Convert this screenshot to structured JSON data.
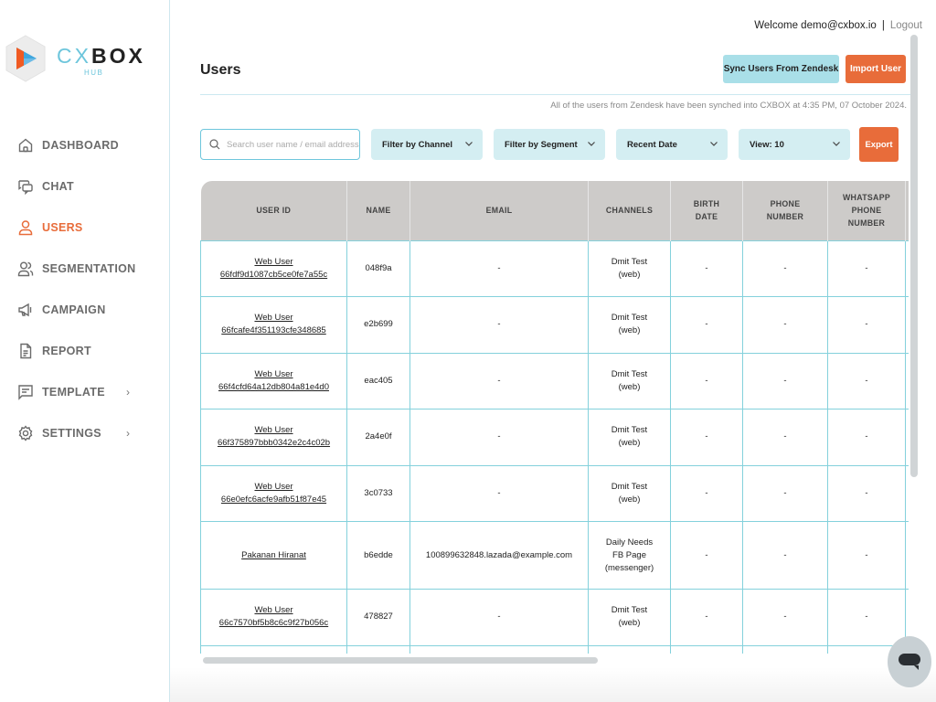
{
  "brand": {
    "name_part1": "CX",
    "name_part2": "BOX",
    "sub": "HUB"
  },
  "header": {
    "welcome": "Welcome demo@cxbox.io",
    "separator": "|",
    "logout": "Logout"
  },
  "sidebar": {
    "items": [
      {
        "label": "DASHBOARD",
        "icon": "home-icon",
        "active": false,
        "has_chevron": false
      },
      {
        "label": "CHAT",
        "icon": "chat-bubbles-icon",
        "active": false,
        "has_chevron": false
      },
      {
        "label": "USERS",
        "icon": "user-icon",
        "active": true,
        "has_chevron": false
      },
      {
        "label": "SEGMENTATION",
        "icon": "users-group-icon",
        "active": false,
        "has_chevron": false
      },
      {
        "label": "CAMPAIGN",
        "icon": "megaphone-icon",
        "active": false,
        "has_chevron": false
      },
      {
        "label": "REPORT",
        "icon": "document-icon",
        "active": false,
        "has_chevron": false
      },
      {
        "label": "TEMPLATE",
        "icon": "template-icon",
        "active": false,
        "has_chevron": true
      },
      {
        "label": "SETTINGS",
        "icon": "gear-icon",
        "active": false,
        "has_chevron": true
      }
    ],
    "chevron": "›"
  },
  "page": {
    "title": "Users",
    "sync_button": "Sync Users From Zendesk",
    "import_button": "Import User",
    "sync_note": "All of the users from Zendesk have been synched into CXBOX at 4:35 PM, 07 October 2024."
  },
  "filters": {
    "search_placeholder": "Search user name / email address",
    "search_value": "",
    "channel": "Filter by Channel",
    "segment": "Filter by Segment",
    "date": "Recent Date",
    "view": "View: 10",
    "export": "Export"
  },
  "colors": {
    "accent": "#e86c3a",
    "primary_light": "#a9dfe8",
    "filter_bg": "#d4eef2",
    "table_border": "#84d1dc",
    "header_bg": "#cdcbc9"
  },
  "table": {
    "columns": [
      "USER ID",
      "NAME",
      "EMAIL",
      "CHANNELS",
      "BIRTH DATE",
      "PHONE NUMBER",
      "WHATSAPP PHONE NUMBER"
    ],
    "rows": [
      {
        "user_line1": "Web User",
        "user_line2": "66fdf9d1087cb5ce0fe7a55c",
        "name": "048f9a",
        "email": "-",
        "channel_lines": [
          "Dmit Test",
          "(web)"
        ],
        "birth": "-",
        "phone": "-",
        "whatsapp": "-"
      },
      {
        "user_line1": "Web User",
        "user_line2": "66fcafe4f351193cfe348685",
        "name": "e2b699",
        "email": "-",
        "channel_lines": [
          "Dmit Test",
          "(web)"
        ],
        "birth": "-",
        "phone": "-",
        "whatsapp": "-"
      },
      {
        "user_line1": "Web User",
        "user_line2": "66f4cfd64a12db804a81e4d0",
        "name": "eac405",
        "email": "-",
        "channel_lines": [
          "Dmit Test",
          "(web)"
        ],
        "birth": "-",
        "phone": "-",
        "whatsapp": "-"
      },
      {
        "user_line1": "Web User",
        "user_line2": "66f375897bbb0342e2c4c02b",
        "name": "2a4e0f",
        "email": "-",
        "channel_lines": [
          "Dmit Test",
          "(web)"
        ],
        "birth": "-",
        "phone": "-",
        "whatsapp": "-"
      },
      {
        "user_line1": "Web User",
        "user_line2": "66e0efc6acfe9afb51f87e45",
        "name": "3c0733",
        "email": "-",
        "channel_lines": [
          "Dmit Test",
          "(web)"
        ],
        "birth": "-",
        "phone": "-",
        "whatsapp": "-"
      },
      {
        "user_line1": "Pakanan Hiranat",
        "user_line2": "",
        "name": "b6edde",
        "email": "100899632848.lazada@example.com",
        "channel_lines": [
          "Daily Needs",
          "FB Page",
          "(messenger)"
        ],
        "birth": "-",
        "phone": "-",
        "whatsapp": "-"
      },
      {
        "user_line1": "Web User",
        "user_line2": "66c7570bf5b8c6c9f27b056c",
        "name": "478827",
        "email": "-",
        "channel_lines": [
          "Dmit Test",
          "(web)"
        ],
        "birth": "-",
        "phone": "-",
        "whatsapp": "-"
      },
      {
        "user_line1": "",
        "user_line2": "",
        "name": "",
        "email": "",
        "channel_lines": [],
        "birth": "",
        "phone": "",
        "whatsapp": ""
      }
    ]
  }
}
